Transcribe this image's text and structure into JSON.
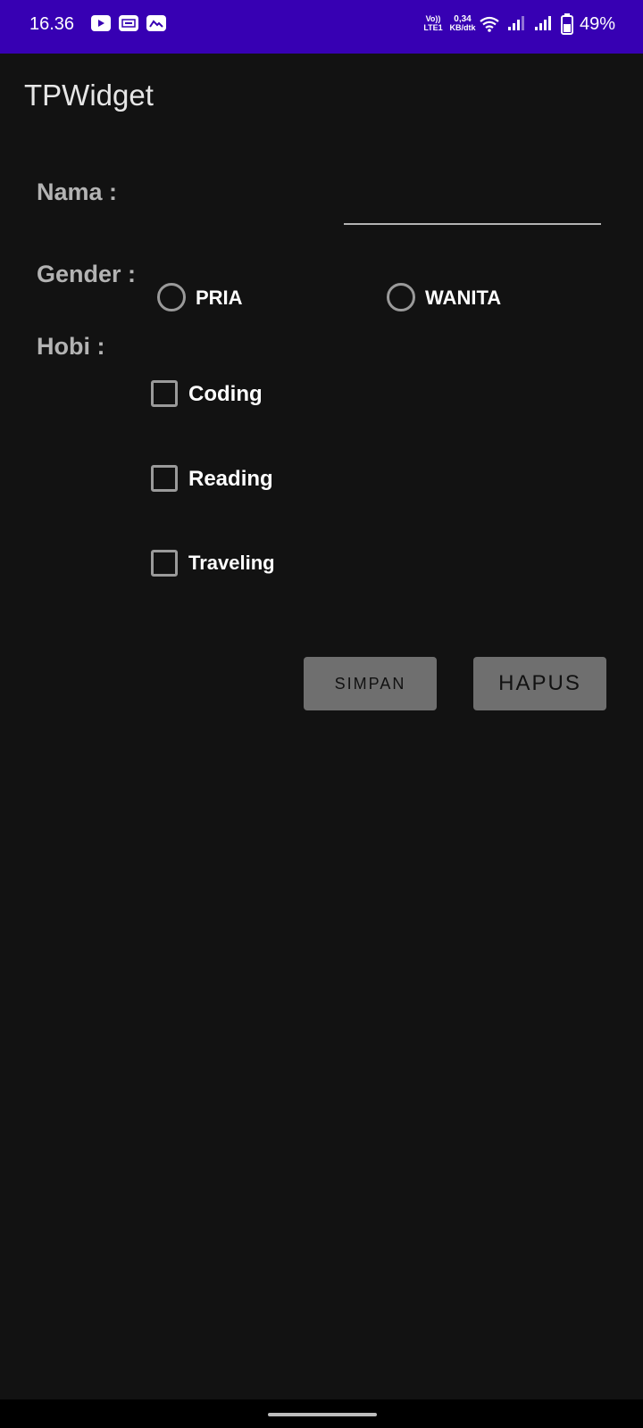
{
  "status_bar": {
    "time": "16.36",
    "notifications": [
      "youtube-icon",
      "ge-icon",
      "gallery-icon"
    ],
    "volte_top": "Vo))",
    "volte_bottom": "LTE1",
    "speed_top": "0,34",
    "speed_bottom": "KB/dtk",
    "battery": "49%",
    "color": "#3700b3"
  },
  "app": {
    "title": "TPWidget"
  },
  "form": {
    "nama_label": "Nama :",
    "nama_value": "",
    "gender_label": "Gender :",
    "gender_options": [
      "PRIA",
      "WANITA"
    ],
    "hobi_label": "Hobi :",
    "hobi_options": [
      "Coding",
      "Reading",
      "Traveling"
    ]
  },
  "buttons": {
    "simpan": "SIMPAN",
    "hapus": "HAPUS"
  }
}
